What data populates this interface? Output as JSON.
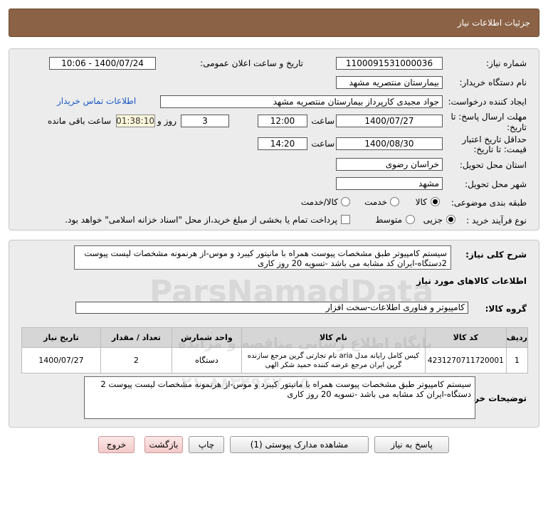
{
  "header": {
    "title": "جزئیات اطلاعات نیاز"
  },
  "fields": {
    "need_number_label": "شماره نیاز:",
    "need_number": "1100091531000036",
    "announce_label": "تاریخ و ساعت اعلان عمومی:",
    "announce_value": "1400/07/24 - 10:06",
    "buyer_org_label": "نام دستگاه خریدار:",
    "buyer_org": "بیمارستان منتصریه مشهد",
    "creator_label": "ایجاد کننده درخواست:",
    "creator": "جواد مجیدی کارپرداز بیمارستان منتصریه مشهد",
    "contact_link": "اطلاعات تماس خریدار",
    "reply_deadline_label_1": "مهلت ارسال پاسخ: تا",
    "reply_deadline_label_2": "تاریخ:",
    "reply_date": "1400/07/27",
    "time_label": "ساعت",
    "reply_time": "12:00",
    "days_value": "3",
    "days_label": "روز و",
    "remaining_time": "01:38:10",
    "remaining_label": "ساعت باقی مانده",
    "validity_label_1": "حداقل تاریخ اعتبار",
    "validity_label_2": "قیمت: تا تاریخ:",
    "validity_date": "1400/08/30",
    "validity_time": "14:20",
    "province_label": "استان محل تحویل:",
    "province": "خراسان رضوی",
    "city_label": "شهر محل تحویل:",
    "city": "مشهد",
    "category_label": "طبقه بندی موضوعی:",
    "cat_opt1": "کالا",
    "cat_opt2": "خدمت",
    "cat_opt3": "کالا/خدمت",
    "process_label": "نوع فرآیند خرید :",
    "proc_opt1": "جزیی",
    "proc_opt2": "متوسط",
    "payment_note": "پرداخت تمام یا بخشی از مبلغ خرید،از محل \"اسناد خزانه اسلامی\" خواهد بود."
  },
  "summary": {
    "label": "شرح کلی نیاز:",
    "text": "سیستم کامپیوتر طبق مشخصات پیوست همراه با مانیتور کیبرد و موس-از هرنمونه مشخصات لیست پیوست 2دستگاه-ایران کد مشابه می باشد -تسویه 20 روز کاری"
  },
  "goods": {
    "section_title": "اطلاعات کالاهای مورد نیاز",
    "group_label": "گروه کالا:",
    "group_value": "کامپیوتر و فناوری اطلاعات-سخت افزار",
    "columns": [
      "ردیف",
      "کد کالا",
      "نام کالا",
      "واحد شمارش",
      "تعداد / مقدار",
      "تاریخ نیاز"
    ],
    "rows": [
      {
        "row": "1",
        "code": "4231270711720001",
        "name": "کیس کامل رایانه مدل aria نام تجارتی گرین مرجع سازنده گرین ایران مرجع عرضه کننده حمید شکر الهی",
        "unit": "دستگاه",
        "qty": "2",
        "date": "1400/07/27"
      }
    ]
  },
  "buyer_notes": {
    "label": "توضیحات خریدار:",
    "text": "سیستم کامپیوتر طبق مشخصات پیوست همراه با مانیتور کیبرد و موس-از هرنمونه مشخصات لیست پیوست 2 دستگاه-ایران کد مشابه می باشد -تسویه 20 روز کاری"
  },
  "buttons": {
    "reply": "پاسخ به نیاز",
    "attachments": "مشاهده مدارک پیوستی (1)",
    "print": "چاپ",
    "back": "بازگشت",
    "exit": "خروج"
  },
  "watermark": {
    "brand": "ParsNamadData",
    "tagline": "پایگاه اطلاع رسانی مناقصه و مزایده",
    "phone": "۰۲۱-۸۸۳۴۹۶۷۰-۵"
  },
  "colors": {
    "header_bg": "#8b6245",
    "panel_bg": "#ececec",
    "link": "#1a58c4",
    "timer_bg": "#fff8dc",
    "exit_bg": "#f3c9c9"
  }
}
